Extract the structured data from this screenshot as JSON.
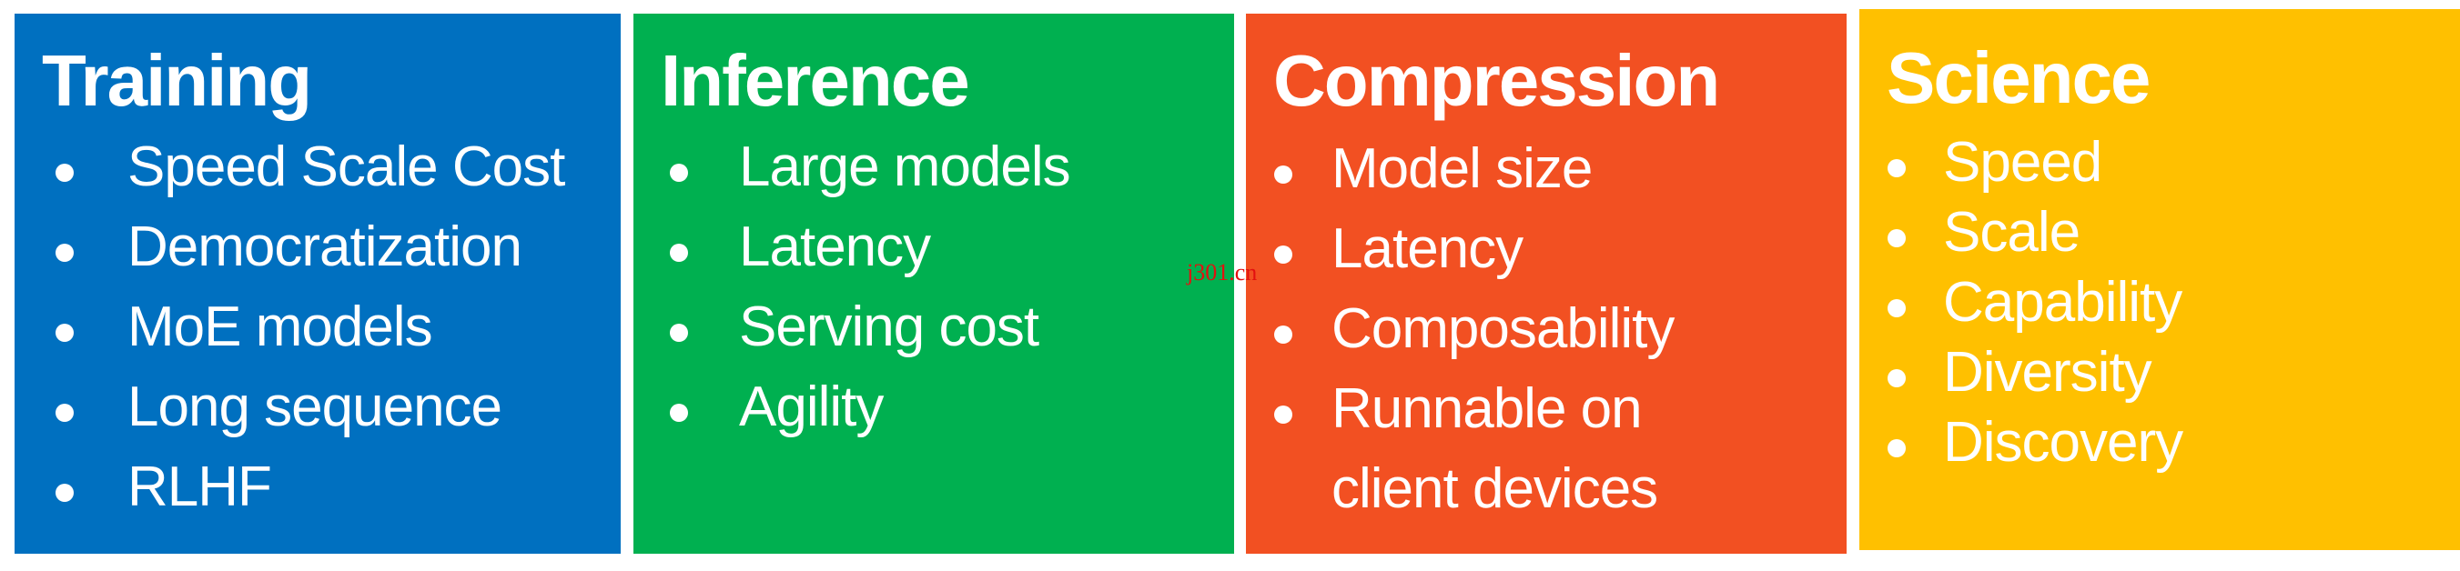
{
  "panels": [
    {
      "id": "training",
      "title": "Training",
      "color": "#0070C0",
      "items": [
        "Speed Scale Cost",
        "Democratization",
        "MoE models",
        "Long sequence",
        "RLHF"
      ]
    },
    {
      "id": "inference",
      "title": "Inference",
      "color": "#00B050",
      "items": [
        "Large models",
        "Latency",
        "Serving cost",
        "Agility"
      ]
    },
    {
      "id": "compression",
      "title": "Compression",
      "color": "#F25022",
      "items": [
        "Model size",
        "Latency",
        "Composability",
        "Runnable on",
        "client devices"
      ]
    },
    {
      "id": "science",
      "title": "Science",
      "color": "#FFC000",
      "items": [
        "Speed",
        "Scale",
        "Capability",
        "Diversity",
        "Discovery"
      ]
    }
  ],
  "watermark": "j301.cn"
}
